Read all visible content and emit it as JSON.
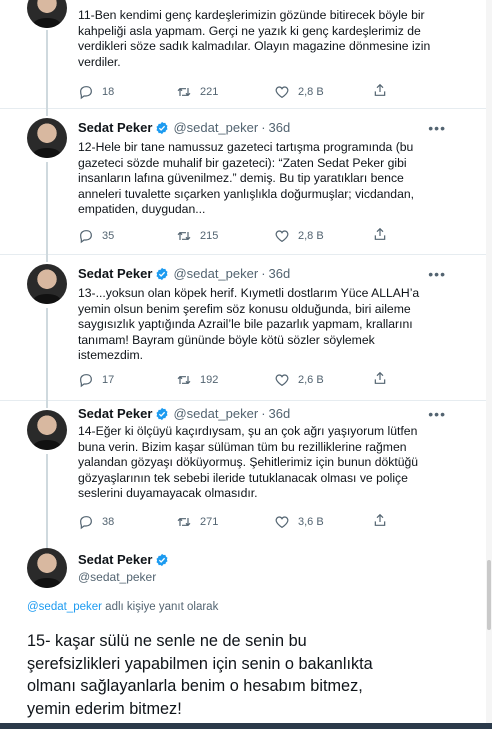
{
  "tweets": [
    {
      "name": "Sedat Peker",
      "handle": "@sedat_peker",
      "time": "36d",
      "text": "11-Ben kendimi genç kardeşlerimizin gözünde bitirecek böyle bir\nkahpeliği asla yapmam. Gerçi ne yazık ki genç kardeşlerimiz de\nverdikleri söze sadık kalmadılar. Olayın magazine dönmesine izin\nverdiler.",
      "replies": "18",
      "retweets": "221",
      "likes": "2,8 B"
    },
    {
      "name": "Sedat Peker",
      "handle": "@sedat_peker",
      "time": "36d",
      "text": "12-Hele bir tane namussuz gazeteci tartışma programında (bu\ngazeteci sözde muhalif bir gazeteci): “Zaten Sedat Peker gibi\ninsanların lafına güvenilmez.” demiş. Bu tip yaratıkları bence\nanneleri tuvalette sıçarken yanlışlıkla doğurmuşlar; vicdandan,\nempatiden, duygudan...",
      "replies": "35",
      "retweets": "215",
      "likes": "2,8 B"
    },
    {
      "name": "Sedat Peker",
      "handle": "@sedat_peker",
      "time": "36d",
      "text": "13-...yoksun olan köpek herif. Kıymetli dostlarım Yüce ALLAH’a\nyemin olsun benim şerefim söz konusu olduğunda, biri aileme\nsaygısızlık yaptığında Azrail’le bile pazarlık yapmam, krallarını\ntanımam! Bayram gününde böyle kötü sözler söylemek\nistemezdim.",
      "replies": "17",
      "retweets": "192",
      "likes": "2,6 B"
    },
    {
      "name": "Sedat Peker",
      "handle": "@sedat_peker",
      "time": "36d",
      "text": "14-Eğer ki ölçüyü kaçırdıysam, şu an çok ağrı yaşıyorum lütfen\nbuna verin. Bizim kaşar sülüman tüm bu rezilliklerine rağmen\nyalandan gözyaşı döküyormuş. Şehitlerimiz için bunun döktüğü\ngözyaşlarının tek sebebi ileride tutuklanacak olması ve poliçe\nseslerini duyamayacak olmasıdır.",
      "replies": "38",
      "retweets": "271",
      "likes": "3,6 B"
    }
  ],
  "main_tweet": {
    "name": "Sedat Peker",
    "handle": "@sedat_peker",
    "reply_link": "@sedat_peker",
    "reply_suffix": " adlı kişiye yanıt olarak",
    "text": "15- kaşar sülü ne senle ne de senin bu\nşerefsizlikleri yapabilmen için senin o bakanlıkta\nolmanı sağlayanlarla benim o hesabım bitmez,\nyemin ederim bitmez!"
  },
  "icons": [
    "reply-icon",
    "retweet-icon",
    "like-icon",
    "share-icon",
    "verified-icon",
    "more-icon"
  ],
  "colors": {
    "accent": "#1d9bf0",
    "secondary": "#536471",
    "text": "#0f1419"
  }
}
